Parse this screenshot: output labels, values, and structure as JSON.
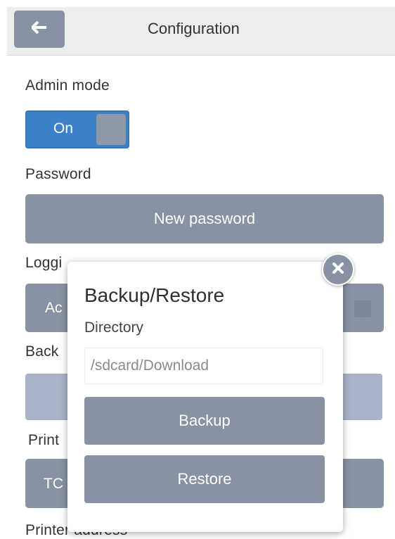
{
  "header": {
    "title": "Configuration",
    "back_icon": "arrow-left-icon"
  },
  "admin": {
    "label": "Admin mode",
    "toggle_label": "On"
  },
  "password": {
    "label": "Password",
    "button_label": "New password"
  },
  "background": {
    "logging_label": "Loggi",
    "logging_button_partial": "Ac",
    "backup_label_partial": "Back",
    "printer_label_partial": "Print",
    "printer_button_partial": "TC",
    "printer_address_partial": "Printer address"
  },
  "dialog": {
    "title": "Backup/Restore",
    "directory_label": "Directory",
    "directory_placeholder": "/sdcard/Download",
    "backup_label": "Backup",
    "restore_label": "Restore",
    "close_icon": "close-icon"
  },
  "colors": {
    "header_bg": "#ededed",
    "button": "#8792a3",
    "toggle_on": "#3b82c9",
    "light_button": "#a9b3c7"
  }
}
